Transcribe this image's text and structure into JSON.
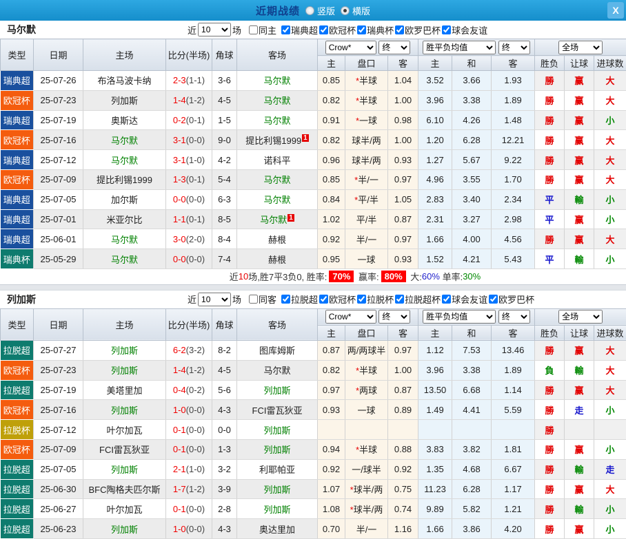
{
  "titlebar": {
    "title": "近期战绩",
    "vertical_label": "竖版",
    "horizontal_label": "横版",
    "close_glyph": "X"
  },
  "colors": {
    "red": "#e30000",
    "green": "#008800",
    "blue": "#1414cc",
    "focus_team": "#008000",
    "score": "#f00000",
    "half": "#454545"
  },
  "league_colors": {
    "瑞典超": "#1a509e",
    "欧冠杯": "#f45c0e",
    "瑞典杯": "#0e7b6e",
    "拉脱超": "#0e7b6e",
    "拉脱杯": "#bfa00a"
  },
  "table_header": {
    "type": "类型",
    "date": "日期",
    "home": "主场",
    "score": "比分(半场)",
    "corner": "角球",
    "away": "客场",
    "bookmaker": "Crow*",
    "final": "终",
    "wdl_avg": "胜平负均值",
    "full": "全场",
    "h_home": "主",
    "h_line": "盘口",
    "h_away": "客",
    "o_home": "主",
    "o_draw": "和",
    "o_away": "客",
    "res": "胜负",
    "ah": "让球",
    "ou": "进球数"
  },
  "sections": [
    {
      "team": "马尔默",
      "near_label": "近",
      "count": "10",
      "games_label": "场",
      "same_label": "同主",
      "leagues": [
        "瑞典超",
        "欧冠杯",
        "瑞典杯",
        "欧罗巴杯",
        "球会友谊"
      ],
      "rows": [
        {
          "league": "瑞典超",
          "date": "25-07-26",
          "home": "布洛马波卡纳",
          "home_focus": false,
          "home_badge": "",
          "score": "2-3",
          "half": "(1-1)",
          "corners": "3-6",
          "away": "马尔默",
          "away_focus": true,
          "away_badge": "",
          "ah_home": "0.85",
          "ah_line": "半球",
          "ah_star": true,
          "ah_away": "1.04",
          "odds_home": "3.52",
          "odds_draw": "3.66",
          "odds_away": "1.93",
          "result": "勝",
          "result_color": "red",
          "ah_result": "赢",
          "ah_result_color": "red",
          "ou_result": "大",
          "ou_result_color": "red"
        },
        {
          "league": "欧冠杯",
          "date": "25-07-23",
          "home": "列加斯",
          "home_focus": false,
          "home_badge": "",
          "score": "1-4",
          "half": "(1-2)",
          "corners": "4-5",
          "away": "马尔默",
          "away_focus": true,
          "away_badge": "",
          "ah_home": "0.82",
          "ah_line": "半球",
          "ah_star": true,
          "ah_away": "1.00",
          "odds_home": "3.96",
          "odds_draw": "3.38",
          "odds_away": "1.89",
          "result": "勝",
          "result_color": "red",
          "ah_result": "赢",
          "ah_result_color": "red",
          "ou_result": "大",
          "ou_result_color": "red"
        },
        {
          "league": "瑞典超",
          "date": "25-07-19",
          "home": "奥斯达",
          "home_focus": false,
          "home_badge": "",
          "score": "0-2",
          "half": "(0-1)",
          "corners": "1-5",
          "away": "马尔默",
          "away_focus": true,
          "away_badge": "",
          "ah_home": "0.91",
          "ah_line": "一球",
          "ah_star": true,
          "ah_away": "0.98",
          "odds_home": "6.10",
          "odds_draw": "4.26",
          "odds_away": "1.48",
          "result": "勝",
          "result_color": "red",
          "ah_result": "赢",
          "ah_result_color": "red",
          "ou_result": "小",
          "ou_result_color": "green"
        },
        {
          "league": "欧冠杯",
          "date": "25-07-16",
          "home": "马尔默",
          "home_focus": true,
          "home_badge": "",
          "score": "3-1",
          "half": "(0-0)",
          "corners": "9-0",
          "away": "提比利锡1999",
          "away_focus": false,
          "away_badge": "1",
          "ah_home": "0.82",
          "ah_line": "球半/两",
          "ah_star": false,
          "ah_away": "1.00",
          "odds_home": "1.20",
          "odds_draw": "6.28",
          "odds_away": "12.21",
          "result": "勝",
          "result_color": "red",
          "ah_result": "赢",
          "ah_result_color": "red",
          "ou_result": "大",
          "ou_result_color": "red"
        },
        {
          "league": "瑞典超",
          "date": "25-07-12",
          "home": "马尔默",
          "home_focus": true,
          "home_badge": "",
          "score": "3-1",
          "half": "(1-0)",
          "corners": "4-2",
          "away": "诺科平",
          "away_focus": false,
          "away_badge": "",
          "ah_home": "0.96",
          "ah_line": "球半/两",
          "ah_star": false,
          "ah_away": "0.93",
          "odds_home": "1.27",
          "odds_draw": "5.67",
          "odds_away": "9.22",
          "result": "勝",
          "result_color": "red",
          "ah_result": "赢",
          "ah_result_color": "red",
          "ou_result": "大",
          "ou_result_color": "red"
        },
        {
          "league": "欧冠杯",
          "date": "25-07-09",
          "home": "提比利锡1999",
          "home_focus": false,
          "home_badge": "",
          "score": "1-3",
          "half": "(0-1)",
          "corners": "5-4",
          "away": "马尔默",
          "away_focus": true,
          "away_badge": "",
          "ah_home": "0.85",
          "ah_line": "半/一",
          "ah_star": true,
          "ah_away": "0.97",
          "odds_home": "4.96",
          "odds_draw": "3.55",
          "odds_away": "1.70",
          "result": "勝",
          "result_color": "red",
          "ah_result": "赢",
          "ah_result_color": "red",
          "ou_result": "大",
          "ou_result_color": "red"
        },
        {
          "league": "瑞典超",
          "date": "25-07-05",
          "home": "加尔斯",
          "home_focus": false,
          "home_badge": "",
          "score": "0-0",
          "half": "(0-0)",
          "corners": "6-3",
          "away": "马尔默",
          "away_focus": true,
          "away_badge": "",
          "ah_home": "0.84",
          "ah_line": "平/半",
          "ah_star": true,
          "ah_away": "1.05",
          "odds_home": "2.83",
          "odds_draw": "3.40",
          "odds_away": "2.34",
          "result": "平",
          "result_color": "blue",
          "ah_result": "輸",
          "ah_result_color": "green",
          "ou_result": "小",
          "ou_result_color": "green"
        },
        {
          "league": "瑞典超",
          "date": "25-07-01",
          "home": "米亚尔比",
          "home_focus": false,
          "home_badge": "",
          "score": "1-1",
          "half": "(0-1)",
          "corners": "8-5",
          "away": "马尔默",
          "away_focus": true,
          "away_badge": "1",
          "ah_home": "1.02",
          "ah_line": "平/半",
          "ah_star": false,
          "ah_away": "0.87",
          "odds_home": "2.31",
          "odds_draw": "3.27",
          "odds_away": "2.98",
          "result": "平",
          "result_color": "blue",
          "ah_result": "赢",
          "ah_result_color": "red",
          "ou_result": "小",
          "ou_result_color": "green"
        },
        {
          "league": "瑞典超",
          "date": "25-06-01",
          "home": "马尔默",
          "home_focus": true,
          "home_badge": "",
          "score": "3-0",
          "half": "(2-0)",
          "corners": "8-4",
          "away": "赫根",
          "away_focus": false,
          "away_badge": "",
          "ah_home": "0.92",
          "ah_line": "半/一",
          "ah_star": false,
          "ah_away": "0.97",
          "odds_home": "1.66",
          "odds_draw": "4.00",
          "odds_away": "4.56",
          "result": "勝",
          "result_color": "red",
          "ah_result": "赢",
          "ah_result_color": "red",
          "ou_result": "大",
          "ou_result_color": "red"
        },
        {
          "league": "瑞典杯",
          "date": "25-05-29",
          "home": "马尔默",
          "home_focus": true,
          "home_badge": "",
          "score": "0-0",
          "half": "(0-0)",
          "corners": "7-4",
          "away": "赫根",
          "away_focus": false,
          "away_badge": "",
          "ah_home": "0.95",
          "ah_line": "一球",
          "ah_star": false,
          "ah_away": "0.93",
          "odds_home": "1.52",
          "odds_draw": "4.21",
          "odds_away": "5.43",
          "result": "平",
          "result_color": "blue",
          "ah_result": "輸",
          "ah_result_color": "green",
          "ou_result": "小",
          "ou_result_color": "green"
        }
      ],
      "summary": {
        "parts": [
          {
            "text": "近",
            "color": "#333333"
          },
          {
            "text": "10",
            "color": "#e60000"
          },
          {
            "text": "场,胜7平3负0, 胜率:",
            "color": "#333333"
          },
          {
            "text": "70%",
            "badge": true
          },
          {
            "text": " 赢率:",
            "color": "#333333"
          },
          {
            "text": "80%",
            "badge": true
          },
          {
            "text": " 大:",
            "color": "#333333"
          },
          {
            "text": "60%",
            "color": "#2222cc"
          },
          {
            "text": " 单率:",
            "color": "#333333"
          },
          {
            "text": "30%",
            "color": "#008800"
          }
        ]
      }
    },
    {
      "team": "列加斯",
      "near_label": "近",
      "count": "10",
      "games_label": "场",
      "same_label": "同客",
      "leagues": [
        "拉脱超",
        "欧冠杯",
        "拉脱杯",
        "拉脱超杯",
        "球会友谊",
        "欧罗巴杯"
      ],
      "rows": [
        {
          "league": "拉脱超",
          "date": "25-07-27",
          "home": "列加斯",
          "home_focus": true,
          "home_badge": "",
          "score": "6-2",
          "half": "(3-2)",
          "corners": "8-2",
          "away": "图库姆斯",
          "away_focus": false,
          "away_badge": "",
          "ah_home": "0.87",
          "ah_line": "两/两球半",
          "ah_star": false,
          "ah_away": "0.97",
          "odds_home": "1.12",
          "odds_draw": "7.53",
          "odds_away": "13.46",
          "result": "勝",
          "result_color": "red",
          "ah_result": "赢",
          "ah_result_color": "red",
          "ou_result": "大",
          "ou_result_color": "red"
        },
        {
          "league": "欧冠杯",
          "date": "25-07-23",
          "home": "列加斯",
          "home_focus": true,
          "home_badge": "",
          "score": "1-4",
          "half": "(1-2)",
          "corners": "4-5",
          "away": "马尔默",
          "away_focus": false,
          "away_badge": "",
          "ah_home": "0.82",
          "ah_line": "半球",
          "ah_star": true,
          "ah_away": "1.00",
          "odds_home": "3.96",
          "odds_draw": "3.38",
          "odds_away": "1.89",
          "result": "負",
          "result_color": "green",
          "ah_result": "輸",
          "ah_result_color": "green",
          "ou_result": "大",
          "ou_result_color": "red"
        },
        {
          "league": "拉脱超",
          "date": "25-07-19",
          "home": "美塔里加",
          "home_focus": false,
          "home_badge": "",
          "score": "0-4",
          "half": "(0-2)",
          "corners": "5-6",
          "away": "列加斯",
          "away_focus": true,
          "away_badge": "",
          "ah_home": "0.97",
          "ah_line": "两球",
          "ah_star": true,
          "ah_away": "0.87",
          "odds_home": "13.50",
          "odds_draw": "6.68",
          "odds_away": "1.14",
          "result": "勝",
          "result_color": "red",
          "ah_result": "赢",
          "ah_result_color": "red",
          "ou_result": "大",
          "ou_result_color": "red"
        },
        {
          "league": "欧冠杯",
          "date": "25-07-16",
          "home": "列加斯",
          "home_focus": true,
          "home_badge": "",
          "score": "1-0",
          "half": "(0-0)",
          "corners": "4-3",
          "away": "FCI雷瓦狄亚",
          "away_focus": false,
          "away_badge": "",
          "ah_home": "0.93",
          "ah_line": "一球",
          "ah_star": false,
          "ah_away": "0.89",
          "odds_home": "1.49",
          "odds_draw": "4.41",
          "odds_away": "5.59",
          "result": "勝",
          "result_color": "red",
          "ah_result": "走",
          "ah_result_color": "blue",
          "ou_result": "小",
          "ou_result_color": "green"
        },
        {
          "league": "拉脱杯",
          "date": "25-07-12",
          "home": "叶尔加瓦",
          "home_focus": false,
          "home_badge": "",
          "score": "0-1",
          "half": "(0-0)",
          "corners": "0-0",
          "away": "列加斯",
          "away_focus": true,
          "away_badge": "",
          "ah_home": "",
          "ah_line": "",
          "ah_star": false,
          "ah_away": "",
          "odds_home": "",
          "odds_draw": "",
          "odds_away": "",
          "result": "勝",
          "result_color": "red",
          "ah_result": "",
          "ah_result_color": "",
          "ou_result": "",
          "ou_result_color": ""
        },
        {
          "league": "欧冠杯",
          "date": "25-07-09",
          "home": "FCI雷瓦狄亚",
          "home_focus": false,
          "home_badge": "",
          "score": "0-1",
          "half": "(0-0)",
          "corners": "1-3",
          "away": "列加斯",
          "away_focus": true,
          "away_badge": "",
          "ah_home": "0.94",
          "ah_line": "半球",
          "ah_star": true,
          "ah_away": "0.88",
          "odds_home": "3.83",
          "odds_draw": "3.82",
          "odds_away": "1.81",
          "result": "勝",
          "result_color": "red",
          "ah_result": "赢",
          "ah_result_color": "red",
          "ou_result": "小",
          "ou_result_color": "green"
        },
        {
          "league": "拉脱超",
          "date": "25-07-05",
          "home": "列加斯",
          "home_focus": true,
          "home_badge": "",
          "score": "2-1",
          "half": "(1-0)",
          "corners": "3-2",
          "away": "利耶帕亚",
          "away_focus": false,
          "away_badge": "",
          "ah_home": "0.92",
          "ah_line": "一/球半",
          "ah_star": false,
          "ah_away": "0.92",
          "odds_home": "1.35",
          "odds_draw": "4.68",
          "odds_away": "6.67",
          "result": "勝",
          "result_color": "red",
          "ah_result": "輸",
          "ah_result_color": "green",
          "ou_result": "走",
          "ou_result_color": "blue"
        },
        {
          "league": "拉脱超",
          "date": "25-06-30",
          "home": "BFC陶格夫匹尔斯",
          "home_focus": false,
          "home_badge": "",
          "score": "1-7",
          "half": "(1-2)",
          "corners": "3-9",
          "away": "列加斯",
          "away_focus": true,
          "away_badge": "",
          "ah_home": "1.07",
          "ah_line": "球半/两",
          "ah_star": true,
          "ah_away": "0.75",
          "odds_home": "11.23",
          "odds_draw": "6.28",
          "odds_away": "1.17",
          "result": "勝",
          "result_color": "red",
          "ah_result": "赢",
          "ah_result_color": "red",
          "ou_result": "大",
          "ou_result_color": "red"
        },
        {
          "league": "拉脱超",
          "date": "25-06-27",
          "home": "叶尔加瓦",
          "home_focus": false,
          "home_badge": "",
          "score": "0-1",
          "half": "(0-0)",
          "corners": "2-8",
          "away": "列加斯",
          "away_focus": true,
          "away_badge": "",
          "ah_home": "1.08",
          "ah_line": "球半/两",
          "ah_star": true,
          "ah_away": "0.74",
          "odds_home": "9.89",
          "odds_draw": "5.82",
          "odds_away": "1.21",
          "result": "勝",
          "result_color": "red",
          "ah_result": "輸",
          "ah_result_color": "green",
          "ou_result": "小",
          "ou_result_color": "green"
        },
        {
          "league": "拉脱超",
          "date": "25-06-23",
          "home": "列加斯",
          "home_focus": true,
          "home_badge": "",
          "score": "1-0",
          "half": "(0-0)",
          "corners": "4-3",
          "away": "奥达里加",
          "away_focus": false,
          "away_badge": "",
          "ah_home": "0.70",
          "ah_line": "半/一",
          "ah_star": false,
          "ah_away": "1.16",
          "odds_home": "1.66",
          "odds_draw": "3.86",
          "odds_away": "4.20",
          "result": "勝",
          "result_color": "red",
          "ah_result": "赢",
          "ah_result_color": "red",
          "ou_result": "小",
          "ou_result_color": "green"
        }
      ]
    }
  ]
}
